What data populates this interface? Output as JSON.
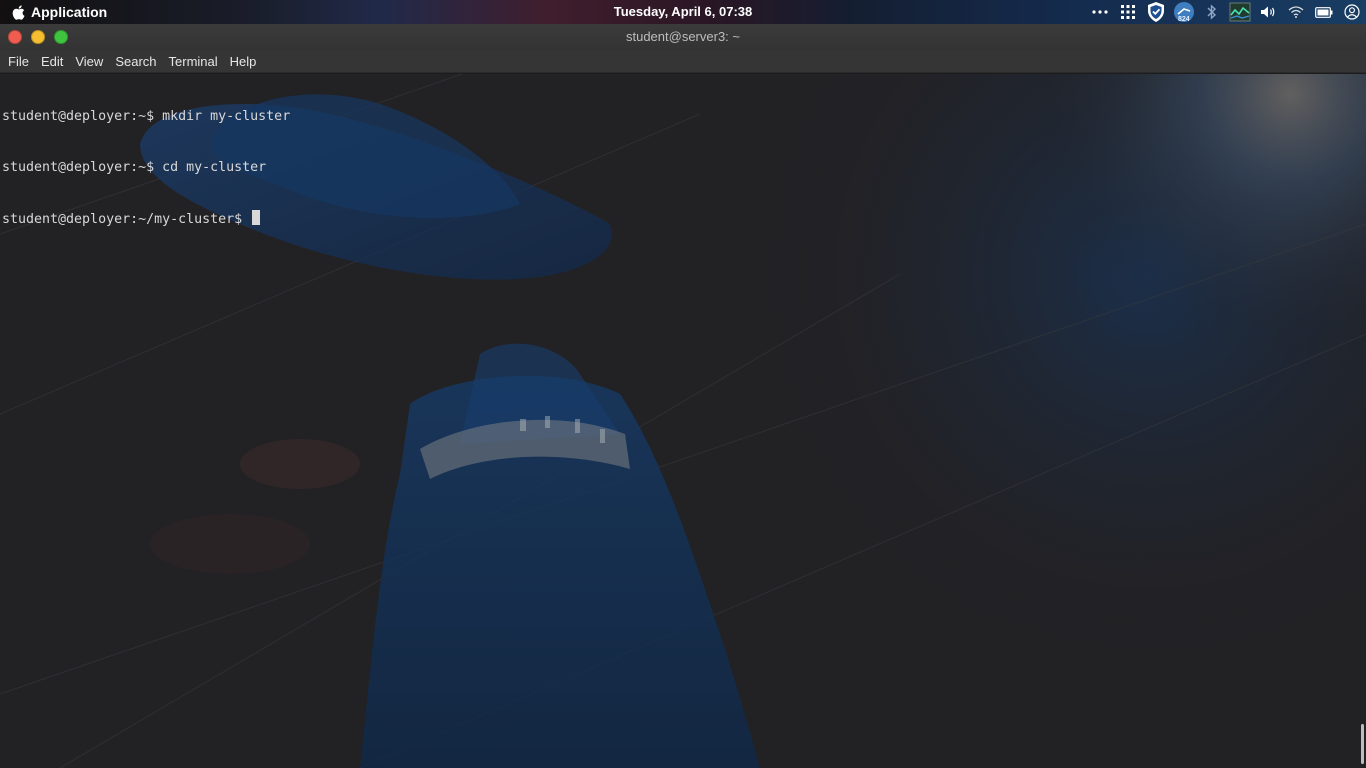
{
  "top_panel": {
    "app_label": "Application",
    "app_icon": "apple-icon",
    "clock": "Tuesday, April  6, 07:38",
    "tray": {
      "icons": [
        "more-dots-icon",
        "grid-icon",
        "shield-icon",
        "network-monitor-icon",
        "bluetooth-icon",
        "system-monitor-icon",
        "volume-icon",
        "wifi-icon",
        "battery-icon",
        "user-icon"
      ],
      "network_badge": "824"
    }
  },
  "window": {
    "title": "student@server3: ~",
    "controls": {
      "close_color": "#ee5d50",
      "minimize_color": "#f5be30",
      "maximize_color": "#3fc43f"
    },
    "menu": {
      "file": "File",
      "edit": "Edit",
      "view": "View",
      "search": "Search",
      "terminal": "Terminal",
      "help": "Help"
    }
  },
  "terminal": {
    "lines": [
      "student@deployer:~$ mkdir my-cluster",
      "student@deployer:~$ cd my-cluster",
      "student@deployer:~/my-cluster$ "
    ],
    "text_color": "#d8d8d8",
    "background_color": "#232225"
  }
}
